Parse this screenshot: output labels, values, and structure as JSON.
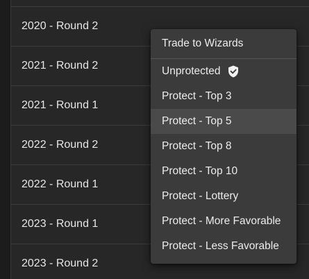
{
  "rows": [
    {
      "label": ""
    },
    {
      "label": "2020 - Round 2"
    },
    {
      "label": "2021 - Round 2"
    },
    {
      "label": "2021 - Round 1"
    },
    {
      "label": "2022 - Round 2"
    },
    {
      "label": "2022 - Round 1"
    },
    {
      "label": "2023 - Round 1"
    },
    {
      "label": "2023 - Round 2"
    }
  ],
  "menu": {
    "items": [
      {
        "label": "Trade to Wizards"
      },
      {
        "label": "Unprotected",
        "icon": "shield-check-icon"
      },
      {
        "label": "Protect - Top 3"
      },
      {
        "label": "Protect - Top 5"
      },
      {
        "label": "Protect - Top 8"
      },
      {
        "label": "Protect - Top 10"
      },
      {
        "label": "Protect - Lottery"
      },
      {
        "label": "Protect - More Favorable"
      },
      {
        "label": "Protect - Less Favorable"
      }
    ],
    "highlighted_label": "Protect - Top 5"
  },
  "colors": {
    "background": "#272727",
    "menu_background": "#3b3b3b",
    "menu_highlight": "#4a4a4a",
    "text": "#e6e6e6"
  }
}
